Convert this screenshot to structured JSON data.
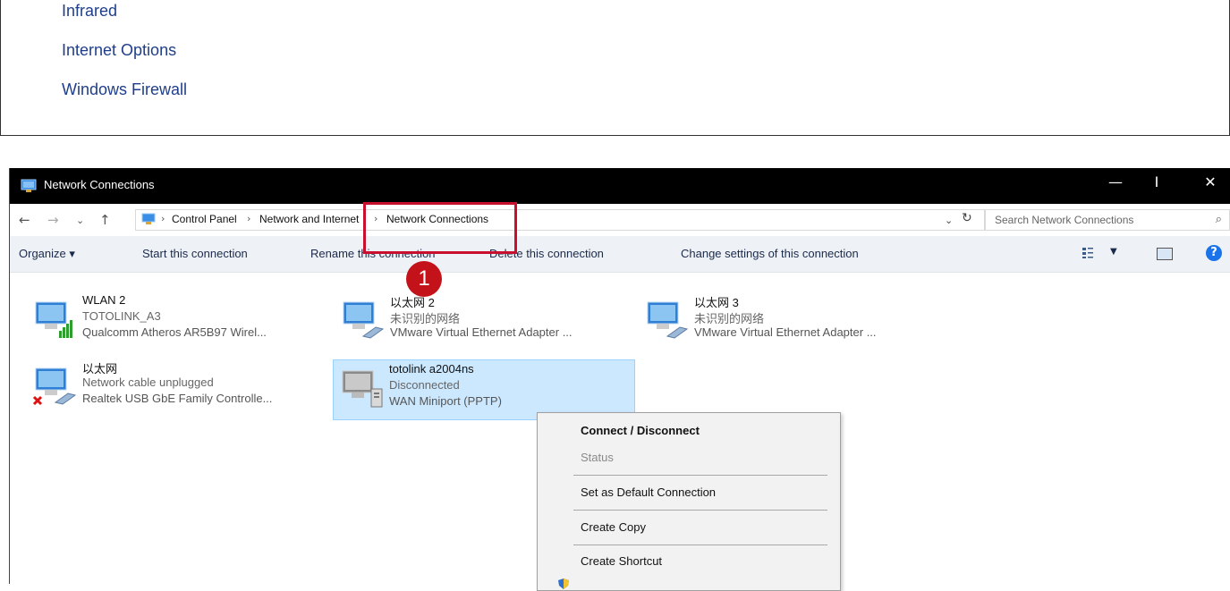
{
  "top_pane": {
    "links": [
      "Infrared",
      "Internet Options",
      "Windows Firewall"
    ]
  },
  "window": {
    "title": "Network Connections",
    "controls": {
      "minimize": "—",
      "maximize": "I",
      "close": "✕"
    }
  },
  "address_bar": {
    "breadcrumb": [
      "Control Panel",
      "Network and Internet",
      "Network Connections"
    ],
    "search_placeholder": "Search Network Connections"
  },
  "command_bar": {
    "organize": "Organize ▾",
    "start": "Start this connection",
    "rename": "Rename this connection",
    "delete": "Delete this connection",
    "change": "Change settings of this connection"
  },
  "connections": [
    {
      "name": "WLAN 2",
      "status": "TOTOLINK_A3",
      "device": "Qualcomm Atheros AR5B97 Wirel...",
      "icon": "wifi-adapter-icon"
    },
    {
      "name": "以太网 2",
      "status": "未识别的网络",
      "device": "VMware Virtual Ethernet Adapter ...",
      "icon": "ethernet-adapter-icon"
    },
    {
      "name": "以太网 3",
      "status": "未识别的网络",
      "device": "VMware Virtual Ethernet Adapter ...",
      "icon": "ethernet-adapter-icon"
    },
    {
      "name": "以太网",
      "status": "Network cable unplugged",
      "device": "Realtek USB GbE Family Controlle...",
      "icon": "ethernet-unplugged-icon"
    },
    {
      "name": "totolink a2004ns",
      "status": "Disconnected",
      "device": "WAN Miniport (PPTP)",
      "icon": "vpn-adapter-icon"
    }
  ],
  "step_badge": "1",
  "context_menu": {
    "items": [
      "Connect / Disconnect",
      "Status",
      "Set as Default Connection",
      "Create Copy",
      "Create Shortcut"
    ]
  },
  "colors": {
    "selection": "#cce8ff",
    "highlight": "#c8102e",
    "badge": "#c4121b",
    "link": "#1f3e8a"
  }
}
